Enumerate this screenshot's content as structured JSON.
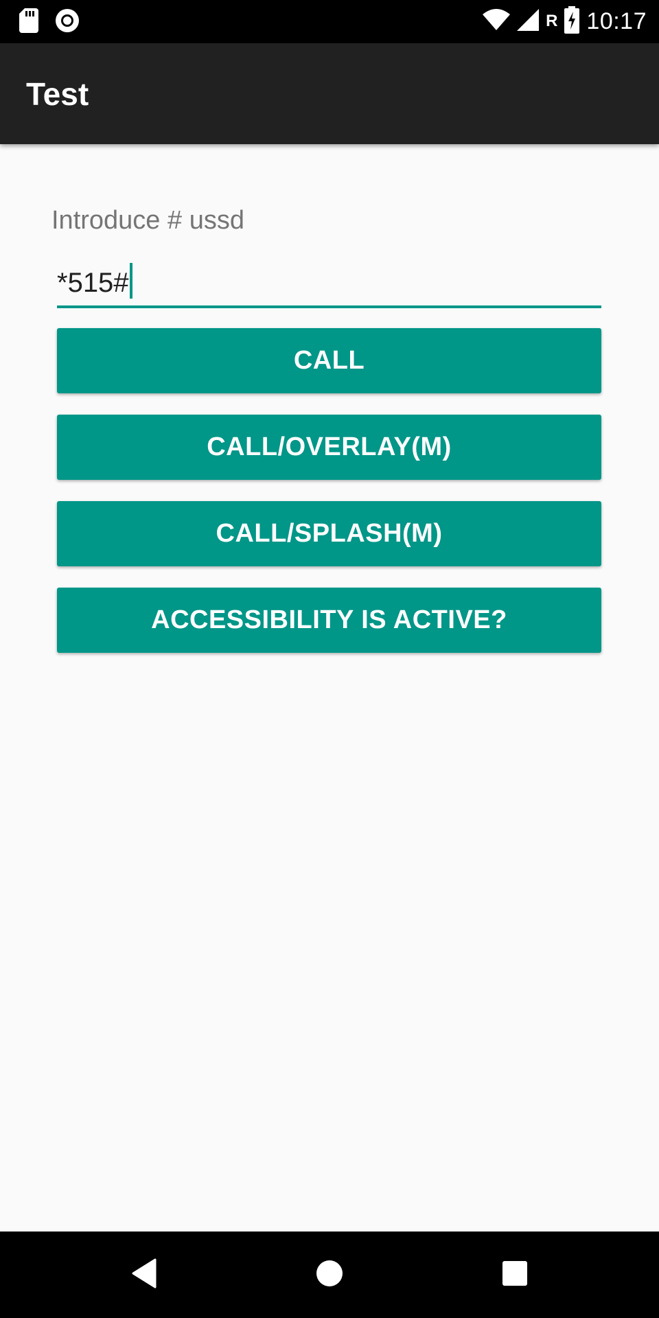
{
  "status_bar": {
    "time": "10:17",
    "roaming_indicator": "R",
    "icons_left": [
      "sd-card-icon",
      "record-icon"
    ],
    "icons_right": [
      "wifi-icon",
      "cell-signal-icon",
      "battery-charging-icon"
    ]
  },
  "app_bar": {
    "title": "Test"
  },
  "form": {
    "label": "Introduce # ussd",
    "input_value": "*515#"
  },
  "buttons": {
    "call": "CALL",
    "call_overlay": "CALL/OVERLAY(M)",
    "call_splash": "CALL/SPLASH(M)",
    "accessibility": "ACCESSIBILITY IS ACTIVE?"
  },
  "nav_bar": {
    "icons": [
      "back-icon",
      "home-icon",
      "recents-icon"
    ]
  },
  "colors": {
    "accent": "#009688",
    "app_bar": "#212121",
    "background": "#fafafa"
  }
}
